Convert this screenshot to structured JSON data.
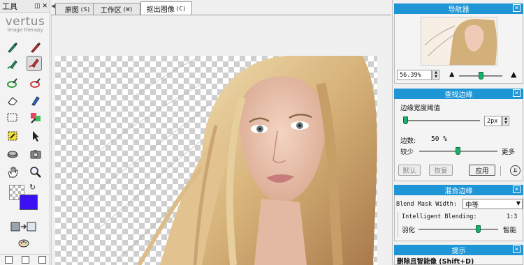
{
  "tools_panel": {
    "title": "工具",
    "logo_text": "vertus",
    "logo_sub": "image therapy",
    "icons": [
      "keep-brush-icon",
      "erase-brush-icon",
      "keep-brush-edge-icon",
      "erase-brush-edge-icon",
      "keep-lasso-icon",
      "erase-lasso-icon",
      "eraser-icon",
      "pen-fill-icon",
      "rect-select-icon",
      "color-replace-icon",
      "magic-select-icon",
      "arrow-pointer-icon",
      "stamp-icon",
      "camera-icon",
      "hand-icon",
      "zoom-icon"
    ],
    "foreground_color": "#3c10f5"
  },
  "tabs": [
    {
      "label": "原图",
      "key": "(S)"
    },
    {
      "label": "工作区",
      "key": "(W)"
    },
    {
      "label": "抠出图像",
      "key": "(C)"
    }
  ],
  "navigator": {
    "title": "导航器",
    "zoom_value": "56.39%"
  },
  "edge_finder": {
    "title": "查找边缘",
    "width_threshold_label": "边缘宽度阈值",
    "width_value": "2px",
    "edge_amount_label": "边数:",
    "edge_amount_value": "50 %",
    "less_label": "较少",
    "more_label": "更多",
    "default_button": "默认",
    "restore_button": "恢复",
    "apply_button": "应用"
  },
  "blend_edges": {
    "title": "混合边缘",
    "mode_label": "Blend Mask Width:",
    "mode_value": "中等",
    "intelligent_label": "Intelligent Blending:",
    "intelligent_value": "1:3",
    "feather_label": "羽化",
    "smart_label": "智能"
  },
  "tips": {
    "title": "提示",
    "text": "删除且智能像 (Shift+D)"
  }
}
